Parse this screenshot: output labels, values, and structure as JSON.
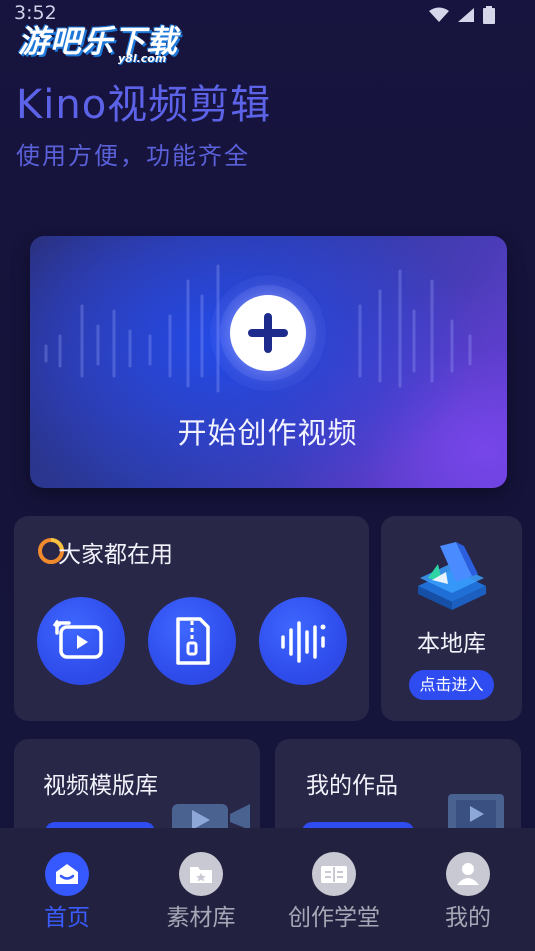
{
  "status_bar": {
    "time": "3:52"
  },
  "watermark": {
    "main": "游吧乐下载",
    "sub": "y8l.com"
  },
  "header": {
    "title": "Kino视频剪辑",
    "subtitle": "使用方便，功能齐全"
  },
  "hero": {
    "label": "开始创作视频",
    "icon": "plus-icon"
  },
  "popular": {
    "title": "大家都在用",
    "icon": "flame-icon",
    "tools": [
      {
        "icon": "video-convert-icon"
      },
      {
        "icon": "zip-compress-icon"
      },
      {
        "icon": "audio-wave-icon"
      }
    ]
  },
  "local_library": {
    "title": "本地库",
    "button": "点击进入",
    "icon": "layers-stack-icon"
  },
  "template_library": {
    "title": "视频模版库",
    "icon": "video-camera-icon"
  },
  "my_works": {
    "title": "我的作品",
    "icon": "play-frame-icon"
  },
  "bottom_nav": {
    "items": [
      {
        "label": "首页",
        "icon": "home-icon",
        "active": true
      },
      {
        "label": "素材库",
        "icon": "folder-icon",
        "active": false
      },
      {
        "label": "创作学堂",
        "icon": "book-icon",
        "active": false
      },
      {
        "label": "我的",
        "icon": "user-icon",
        "active": false
      }
    ]
  },
  "colors": {
    "accent": "#2f4cf0",
    "background": "#15133a",
    "card": "#282748",
    "title": "#5d63e8"
  }
}
